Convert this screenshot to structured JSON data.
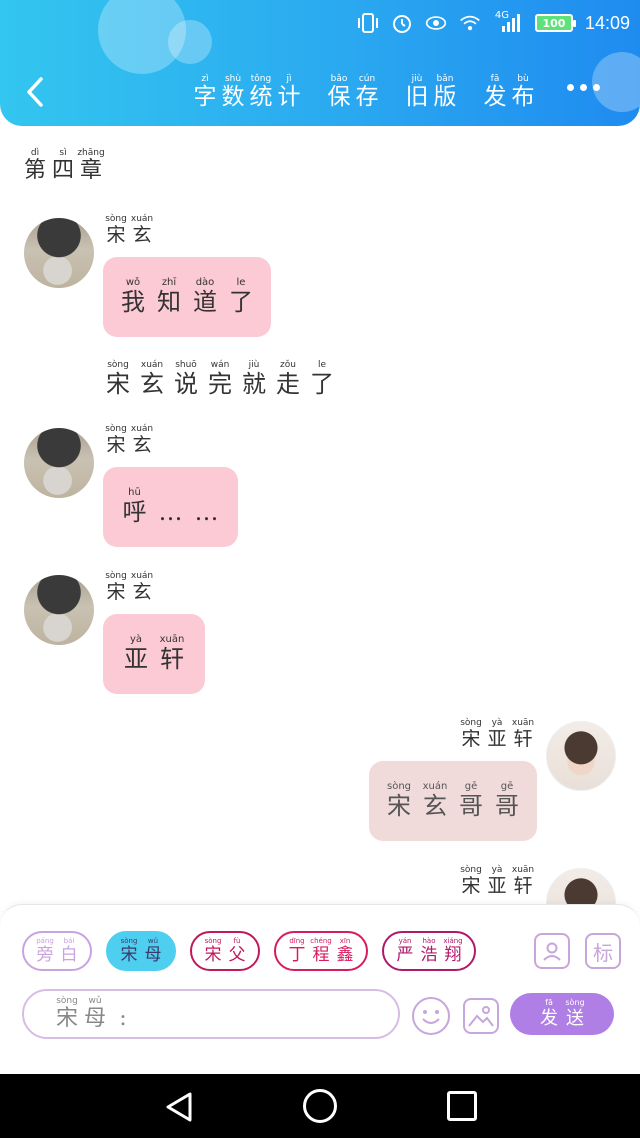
{
  "status": {
    "network": "4G",
    "battery": "100",
    "time": "14:09"
  },
  "header": {
    "actions": [
      {
        "id": "word-count",
        "chars": [
          [
            "字",
            "zì"
          ],
          [
            "数",
            "shù"
          ],
          [
            "统",
            "tǒng"
          ],
          [
            "计",
            "jì"
          ]
        ]
      },
      {
        "id": "save",
        "chars": [
          [
            "保",
            "bǎo"
          ],
          [
            "存",
            "cún"
          ]
        ]
      },
      {
        "id": "old-version",
        "chars": [
          [
            "旧",
            "jiù"
          ],
          [
            "版",
            "bǎn"
          ]
        ]
      },
      {
        "id": "publish",
        "chars": [
          [
            "发",
            "fā"
          ],
          [
            "布",
            "bù"
          ]
        ]
      }
    ]
  },
  "chapter": [
    [
      "第",
      "dì"
    ],
    [
      "四",
      "sì"
    ],
    [
      "章",
      "zhāng"
    ]
  ],
  "messages": {
    "m1": {
      "speaker": [
        [
          "宋",
          "sòng"
        ],
        [
          "玄",
          "xuán"
        ]
      ],
      "text": [
        [
          "我",
          "wǒ"
        ],
        [
          "知",
          "zhī"
        ],
        [
          "道",
          "dào"
        ],
        [
          "了",
          "le"
        ]
      ]
    },
    "narration": [
      [
        "宋",
        "sòng"
      ],
      [
        "玄",
        "xuán"
      ],
      [
        "说",
        "shuō"
      ],
      [
        "完",
        "wán"
      ],
      [
        "就",
        "jiù"
      ],
      [
        "走",
        "zǒu"
      ],
      [
        "了",
        "le"
      ]
    ],
    "m2": {
      "speaker": [
        [
          "宋",
          "sòng"
        ],
        [
          "玄",
          "xuán"
        ]
      ],
      "text": [
        [
          "呼",
          "hū"
        ],
        [
          "…",
          ""
        ],
        [
          "…",
          ""
        ]
      ]
    },
    "m3": {
      "speaker": [
        [
          "宋",
          "sòng"
        ],
        [
          "玄",
          "xuán"
        ]
      ],
      "text": [
        [
          "亚",
          "yà"
        ],
        [
          "轩",
          "xuān"
        ]
      ]
    },
    "m4": {
      "speaker": [
        [
          "宋",
          "sòng"
        ],
        [
          "亚",
          "yà"
        ],
        [
          "轩",
          "xuān"
        ]
      ],
      "text": [
        [
          "宋",
          "sòng"
        ],
        [
          "玄",
          "xuán"
        ],
        [
          "哥",
          "gē"
        ],
        [
          "哥",
          "gē"
        ]
      ]
    },
    "m5": {
      "speaker": [
        [
          "宋",
          "sòng"
        ],
        [
          "亚",
          "yà"
        ],
        [
          "轩",
          "xuān"
        ]
      ]
    }
  },
  "characters": [
    {
      "id": "pang-bai",
      "chars": [
        [
          "旁",
          "páng"
        ],
        [
          "白",
          "bái"
        ]
      ],
      "color": "#c9a3e0",
      "active": false
    },
    {
      "id": "song-mu",
      "chars": [
        [
          "宋",
          "sòng"
        ],
        [
          "母",
          "wǔ"
        ]
      ],
      "color": "#4ecff0",
      "active": true
    },
    {
      "id": "song-fu",
      "chars": [
        [
          "宋",
          "sòng"
        ],
        [
          "父",
          "fù"
        ]
      ],
      "color": "#c2185b",
      "active": false
    },
    {
      "id": "ding-chengxin",
      "chars": [
        [
          "丁",
          "dīng"
        ],
        [
          "程",
          "chéng"
        ],
        [
          "鑫",
          "xīn"
        ]
      ],
      "color": "#d81b60",
      "active": false
    },
    {
      "id": "yan-haoxiang",
      "chars": [
        [
          "严",
          "yán"
        ],
        [
          "浩",
          "hào"
        ],
        [
          "翔",
          "xiáng"
        ]
      ],
      "color": "#b0186a",
      "active": false
    }
  ],
  "input": {
    "chars": [
      [
        "宋",
        "sòng"
      ],
      [
        "母",
        "wǔ"
      ],
      [
        ":",
        ""
      ]
    ]
  },
  "send": {
    "chars": [
      [
        "发",
        "fā"
      ],
      [
        "送",
        "sòng"
      ]
    ]
  },
  "tag_button": "标",
  "colors": {
    "header": "#2aa8f0",
    "bubble": "#fccad5",
    "accent": "#b07fe6",
    "border": "#d7bce6"
  }
}
